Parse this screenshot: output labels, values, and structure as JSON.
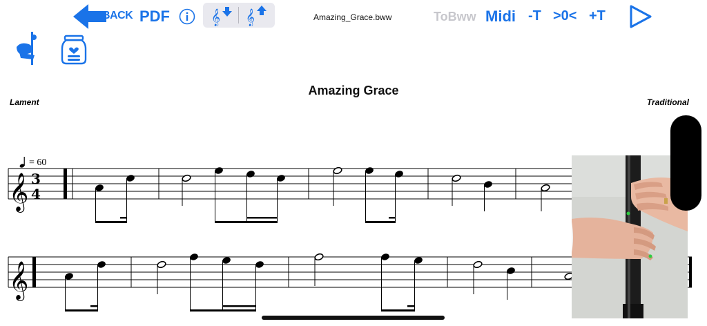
{
  "toolbar": {
    "back_label": "BACK",
    "pdf_label": "PDF",
    "info_icon": "info-icon",
    "transpose_down_icon": "clef-arrow-down-icon",
    "transpose_up_icon": "clef-arrow-up-icon",
    "filename": "Amazing_Grace.bww",
    "tobww_label": "ToBww",
    "midi_label": "Midi",
    "tempo_down_label": "-T",
    "tempo_reset_label": ">0<",
    "tempo_up_label": "+T",
    "play_icon": "play-icon",
    "accent_color": "#1a73e8",
    "disabled_color": "#c7c7cc"
  },
  "secondary": {
    "piper_icon": "bagpiper-icon",
    "tip_jar_icon": "tip-jar-icon"
  },
  "score": {
    "title": "Amazing Grace",
    "tempo_type": "Lament",
    "composer": "Traditional",
    "tempo_marking": "= 60",
    "time_signature_top": "3",
    "time_signature_bottom": "4"
  },
  "video": {
    "description_icon": "fingering-video"
  }
}
